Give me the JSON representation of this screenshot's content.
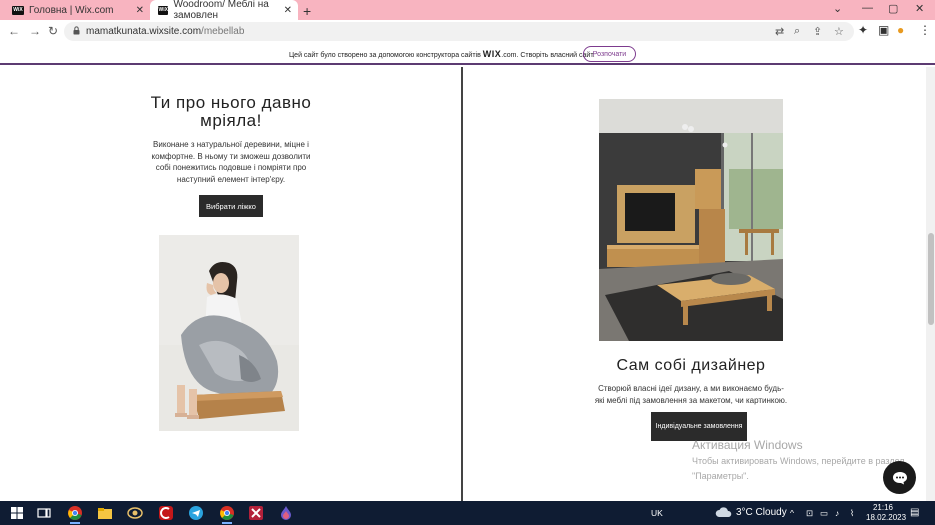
{
  "browser": {
    "tabs": [
      {
        "favicon": "WiX",
        "title": "Головна | Wix.com"
      },
      {
        "favicon": "WiX",
        "title": "Woodroom/ Меблі на замовлен"
      }
    ],
    "url_domain": "mamatkunata.wixsite.com",
    "url_path": "/mebellab"
  },
  "wix_banner": {
    "message_before": "Цей сайт було створено за допомогою конструктора сайтів",
    "logo": "WIX",
    "message_after": ".com. Створіть власний сайт.",
    "cta": "Розпочати"
  },
  "left_block": {
    "title": "Ти про нього давно мріяла!",
    "description": "Виконане з натуральної деревини, міцне і комфортне. В ньому ти зможеш дозволити собі понежитись подовше і помріяти про наступний елемент інтер'єру.",
    "button": "Вибрати ліжко"
  },
  "right_block": {
    "title": "Сам собі дизайнер",
    "description": "Створюй власні ідеї дизану, а ми виконаємо будь-які меблі під замовлення за макетом, чи картинкою.",
    "button": "Індивідуальне замовлення"
  },
  "watermark": {
    "heading": "Активация Windows",
    "line1": "Чтобы активировать Windows, перейдите в раздел",
    "line2": "\"Параметры\"."
  },
  "taskbar": {
    "language": "UK",
    "weather": "3°C  Cloudy",
    "time": "21:16",
    "date": "18.02.2023"
  }
}
